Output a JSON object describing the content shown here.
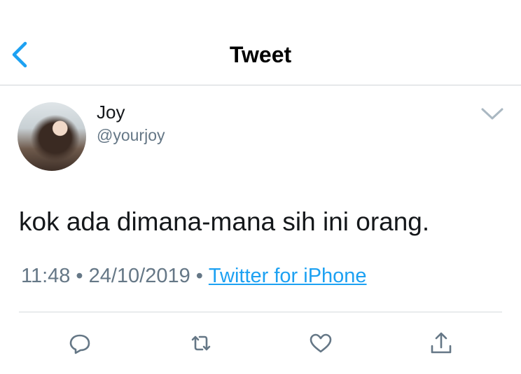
{
  "header": {
    "title": "Tweet",
    "back_icon": "chevron-left-icon"
  },
  "tweet": {
    "author_name": "Joy",
    "handle": "@yourjoy",
    "text": "kok ada dimana-mana sih ini orang.",
    "time": "11:48",
    "date": "24/10/2019",
    "separator": "•",
    "source": "Twitter for iPhone",
    "more_icon": "chevron-down-icon"
  },
  "actions": [
    {
      "name": "reply",
      "icon": "reply-icon"
    },
    {
      "name": "retweet",
      "icon": "retweet-icon"
    },
    {
      "name": "like",
      "icon": "heart-icon"
    },
    {
      "name": "share",
      "icon": "share-icon"
    }
  ],
  "colors": {
    "accent": "#1da1f2",
    "secondary_text": "#657786",
    "divider": "#cfd4d8"
  }
}
